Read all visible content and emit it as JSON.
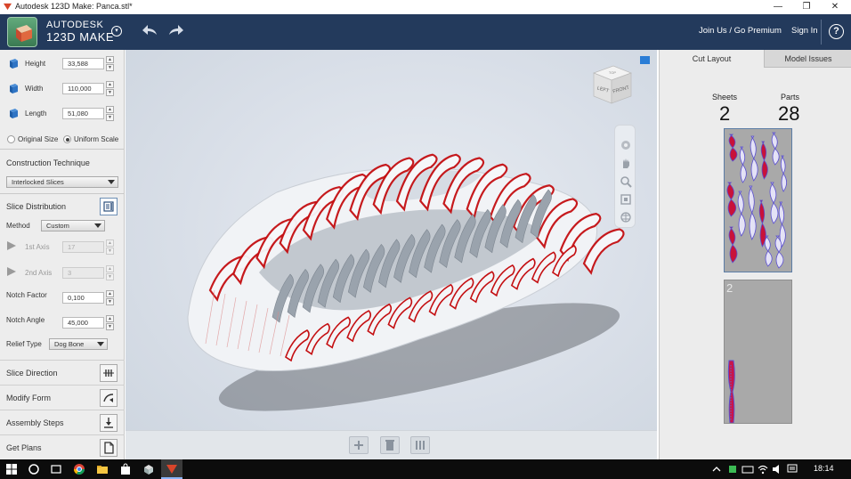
{
  "window": {
    "title": "Autodesk 123D Make: Panca.stl*",
    "minimize_glyph": "—",
    "restore_glyph": "❐",
    "close_glyph": "✕"
  },
  "header": {
    "brand_line1": "AUTODESK",
    "brand_line2": "123D MAKE",
    "menu_glyph": "▾",
    "join_label": "Join Us / Go Premium",
    "sign_in_label": "Sign In",
    "help_glyph": "?",
    "accent_color": "#233a5c"
  },
  "dimensions": {
    "height": {
      "label": "Height",
      "value": "33,588"
    },
    "width": {
      "label": "Width",
      "value": "110,000"
    },
    "length": {
      "label": "Length",
      "value": "51,080"
    },
    "scale_options": [
      {
        "label": "Original Size",
        "selected": false
      },
      {
        "label": "Uniform Scale",
        "selected": true
      }
    ]
  },
  "construction": {
    "title": "Construction Technique",
    "selected": "Interlocked Slices"
  },
  "slice_distribution": {
    "title": "Slice Distribution",
    "method_label": "Method",
    "method_value": "Custom",
    "axis1_label": "1st Axis",
    "axis1_value": "17",
    "axis2_label": "2nd Axis",
    "axis2_value": "3",
    "notch_factor_label": "Notch Factor",
    "notch_factor_value": "0,100",
    "notch_angle_label": "Notch Angle",
    "notch_angle_value": "45,000",
    "relief_type_label": "Relief Type",
    "relief_type_value": "Dog Bone"
  },
  "tools": [
    {
      "label": "Slice Direction",
      "icon": "slice-direction-icon"
    },
    {
      "label": "Modify Form",
      "icon": "modify-form-icon"
    },
    {
      "label": "Assembly Steps",
      "icon": "assembly-steps-icon"
    },
    {
      "label": "Get Plans",
      "icon": "get-plans-icon"
    }
  ],
  "viewport": {
    "viewcube_left": "LEFT",
    "viewcube_front": "FRONT",
    "viewcube_top": "TOP",
    "slice_color": "#c40f12",
    "body_color": "#9aa3ad"
  },
  "right_panel": {
    "tabs": [
      {
        "label": "Cut Layout",
        "active": true
      },
      {
        "label": "Model Issues",
        "active": false
      }
    ],
    "sheets_label": "Sheets",
    "sheets_value": "2",
    "parts_label": "Parts",
    "parts_value": "28",
    "sheet2_label": "2"
  },
  "taskbar": {
    "time": "18:14"
  }
}
